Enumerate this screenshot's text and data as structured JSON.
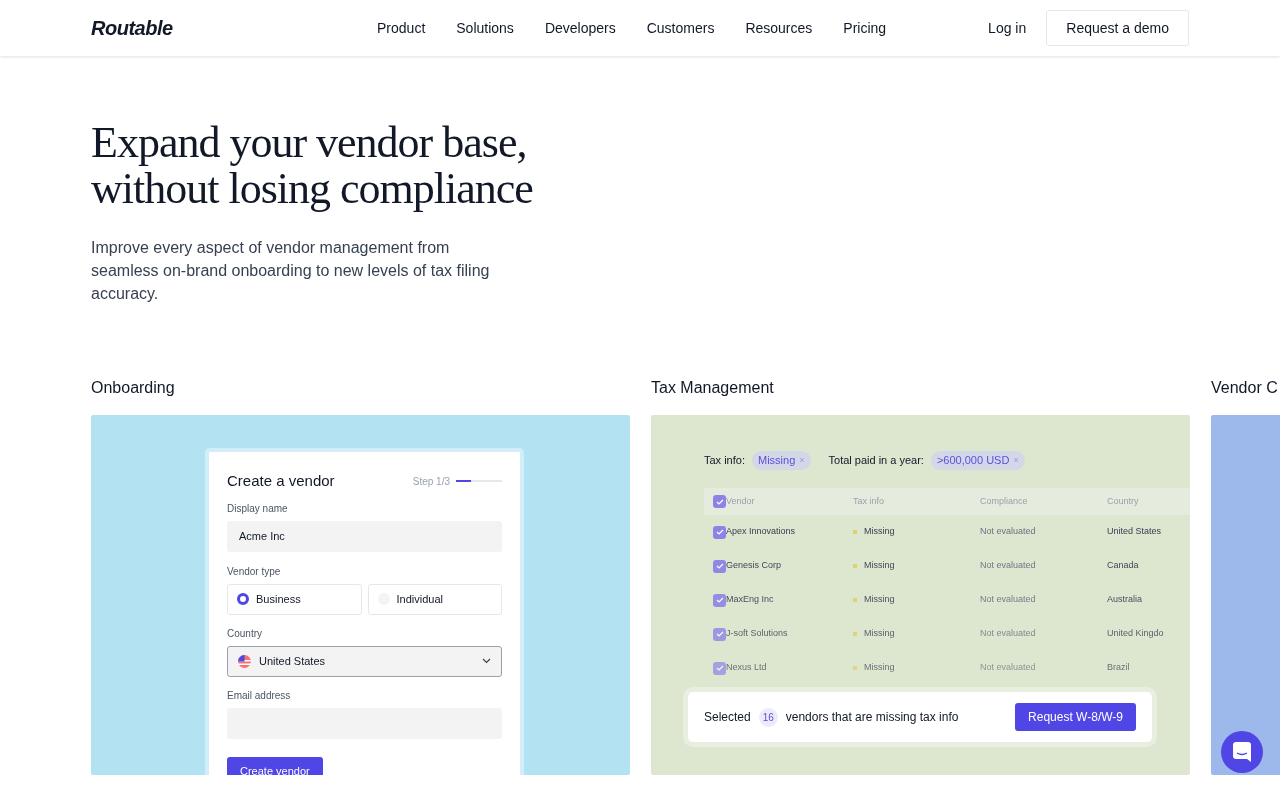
{
  "nav": {
    "logo": "Routable",
    "links": [
      "Product",
      "Solutions",
      "Developers",
      "Customers",
      "Resources",
      "Pricing"
    ],
    "login": "Log in",
    "cta": "Request a demo"
  },
  "hero": {
    "title_lines": [
      "Expand your vendor base,",
      "without losing compliance"
    ],
    "text": "Improve every aspect of vendor management from seamless on-brand onboarding to new levels of tax filing accuracy."
  },
  "onboarding": {
    "heading": "Onboarding",
    "form": {
      "title": "Create a vendor",
      "step": "Step 1/3",
      "level": 0.33,
      "name_label": "Display name",
      "name_value": "Acme Inc",
      "type_label": "Vendor type",
      "types": [
        {
          "label": "Business",
          "selected": true
        },
        {
          "label": "Individual",
          "selected": false
        }
      ],
      "country_label": "Country",
      "country_value": "United States",
      "email_label": "Email address",
      "submit": "Create vendor"
    }
  },
  "tax": {
    "heading": "Tax Management",
    "filters": [
      {
        "label": "Tax info:",
        "value": "Missing",
        "remove": "×"
      },
      {
        "label": "Total paid in a year:",
        "value": ">600,000 USD",
        "remove": "×"
      }
    ],
    "header_checked": true,
    "columns": [
      "Vendor",
      "Tax info",
      "Compliance",
      "Country"
    ],
    "rows": [
      {
        "checked": true,
        "cells": [
          "Apex Innovations",
          "Missing",
          "Not evaluated",
          "United States"
        ]
      },
      {
        "checked": true,
        "cells": [
          "Genesis Corp",
          "Missing",
          "Not evaluated",
          "Canada"
        ]
      },
      {
        "checked": true,
        "cells": [
          "MaxEng Inc",
          "Missing",
          "Not evaluated",
          "Australia"
        ]
      },
      {
        "checked": true,
        "cells": [
          "J-soft Solutions",
          "Missing",
          "Not evaluated",
          "United Kingdo"
        ]
      },
      {
        "checked": true,
        "cells": [
          "Nexus Ltd",
          "Missing",
          "Not evaluated",
          "Brazil"
        ]
      }
    ],
    "selection": {
      "before": "Selected",
      "count": "16",
      "after": "vendors that are missing tax info",
      "button": "Request W-8/W-9"
    }
  },
  "third": {
    "heading": "Vendor C"
  }
}
